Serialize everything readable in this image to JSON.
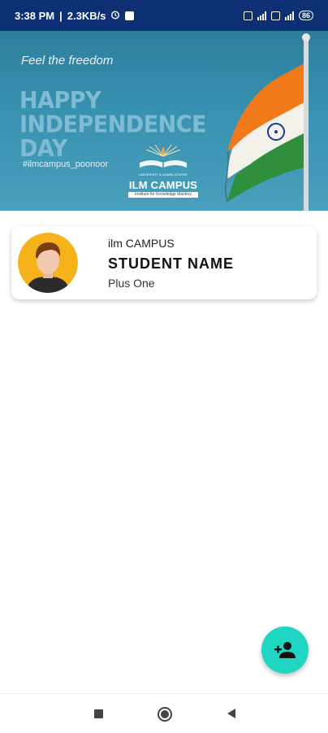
{
  "status_bar": {
    "time": "3:38 PM",
    "speed": "2.3KB/s",
    "battery": "86"
  },
  "banner": {
    "tagline": "Feel the freedom",
    "headline_line1": "HAPPY",
    "headline_line2": "INDEPENDENCE",
    "headline_line3": "DAY",
    "hashtag": "#ilmcampus_poonoor",
    "logo_title": "ILM CAMPUS",
    "logo_subtitle": "Institute for Knowledge Mastery",
    "logo_top_caption": "UNIVERSITY & LEARN CENTRE"
  },
  "profile": {
    "org": "ilm CAMPUS",
    "name": "STUDENT NAME",
    "class": "Plus One"
  },
  "fab": {
    "icon": "add-person-icon",
    "color": "#1fd6c2"
  },
  "navbar": {
    "recents_icon": "square-icon",
    "home_icon": "circle-icon",
    "back_icon": "triangle-back-icon"
  },
  "colors": {
    "status_bar": "#0d2f74",
    "accent": "#1fd6c2"
  }
}
